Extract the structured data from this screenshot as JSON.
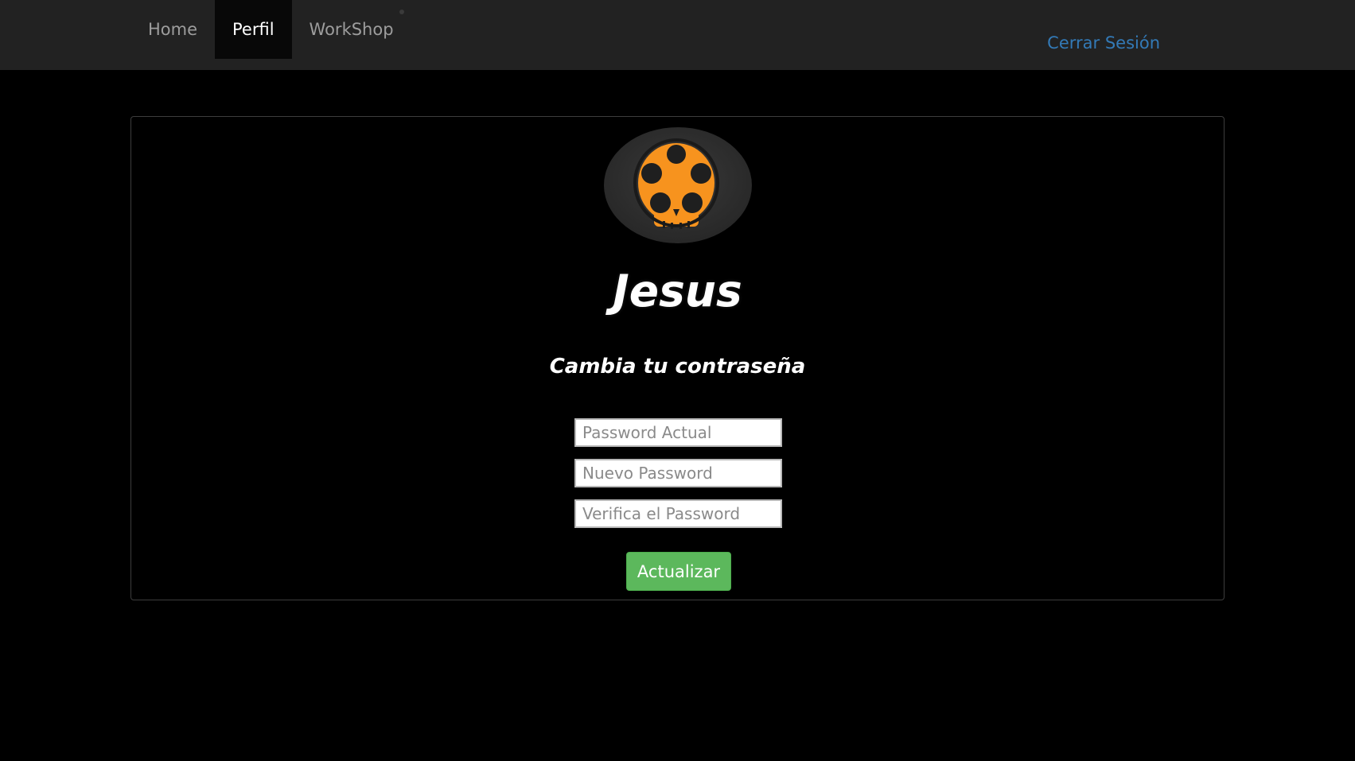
{
  "nav": {
    "items": [
      {
        "label": "Home",
        "active": false
      },
      {
        "label": "Perfil",
        "active": true
      },
      {
        "label": "WorkShop",
        "active": false
      }
    ],
    "logout_label": "Cerrar Sesión"
  },
  "profile": {
    "avatar_icon": "skull-reel-icon",
    "username": "Jesus"
  },
  "password_form": {
    "title": "Cambia tu contraseña",
    "current_placeholder": "Password Actual",
    "new_placeholder": "Nuevo Password",
    "verify_placeholder": "Verifica el Password",
    "submit_label": "Actualizar"
  },
  "colors": {
    "navbar_bg": "#222222",
    "active_tab_bg": "#080808",
    "link": "#337ab7",
    "submit": "#5cb85c",
    "avatar_orange": "#f7931e"
  }
}
